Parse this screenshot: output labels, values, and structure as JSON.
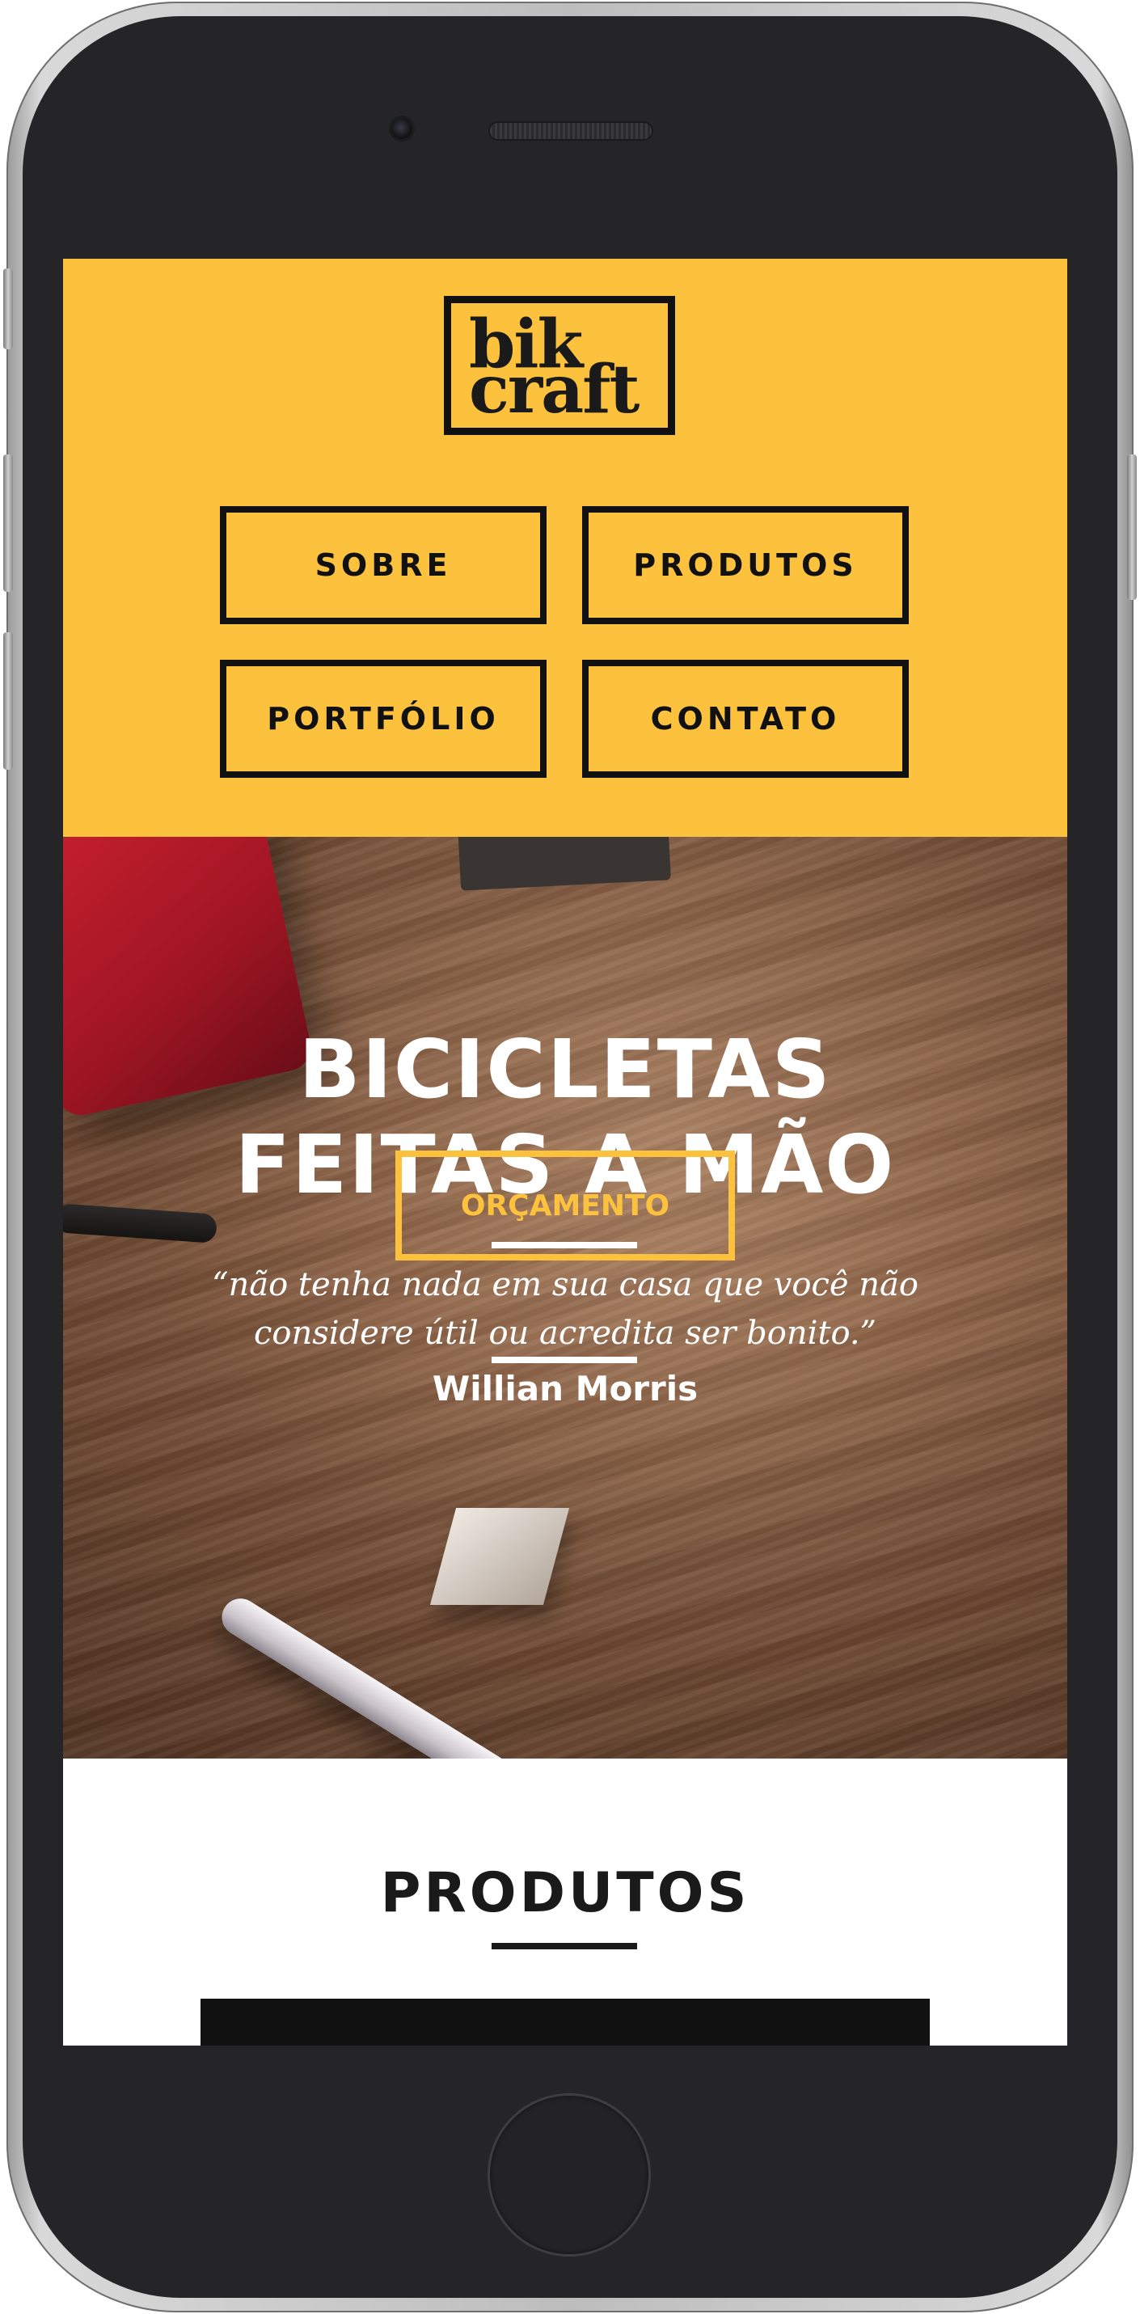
{
  "brand": {
    "logo_line_1": "bik",
    "logo_line_2": "craft"
  },
  "nav": {
    "items": [
      {
        "label": "SOBRE"
      },
      {
        "label": "PRODUTOS"
      },
      {
        "label": "PORTFÓLIO"
      },
      {
        "label": "CONTATO"
      }
    ]
  },
  "hero": {
    "title_line_1": "BICICLETAS",
    "title_line_2": "FEITAS A MÃO",
    "quote_line_1": "“não tenha nada em sua casa que você não",
    "quote_line_2": "considere útil ou acredita ser bonito.”",
    "author": "Willian Morris",
    "cta_label": "ORÇAMENTO"
  },
  "produtos": {
    "title": "PRODUTOS"
  },
  "colors": {
    "accent": "#fcc23e",
    "dark": "#111111",
    "text_light": "#ffffff"
  },
  "icons": {
    "logo": "bikcraft-logo",
    "camera": "front-camera-icon",
    "speaker": "earpiece-speaker-icon",
    "home": "home-button-icon"
  }
}
